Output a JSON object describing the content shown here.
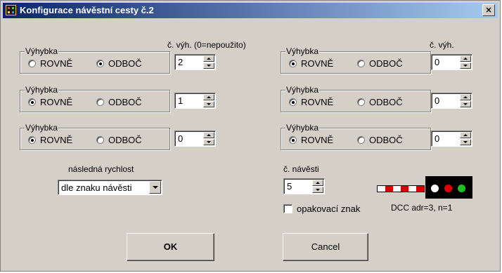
{
  "window": {
    "title": "Konfigurace návěstní cesty č.2",
    "close_label": "×"
  },
  "switches": [
    {
      "legend": "Výhybka",
      "straight_label": "ROVNĚ",
      "branch_label": "ODBOČ",
      "selected": "branch",
      "number": "2"
    },
    {
      "legend": "Výhybka",
      "straight_label": "ROVNĚ",
      "branch_label": "ODBOČ",
      "selected": "straight",
      "number": "1"
    },
    {
      "legend": "Výhybka",
      "straight_label": "ROVNĚ",
      "branch_label": "ODBOČ",
      "selected": "straight",
      "number": "0"
    },
    {
      "legend": "Výhybka",
      "straight_label": "ROVNĚ",
      "branch_label": "ODBOČ",
      "selected": "straight",
      "number": "0"
    },
    {
      "legend": "Výhybka",
      "straight_label": "ROVNĚ",
      "branch_label": "ODBOČ",
      "selected": "straight",
      "number": "0"
    },
    {
      "legend": "Výhybka",
      "straight_label": "ROVNĚ",
      "branch_label": "ODBOČ",
      "selected": "straight",
      "number": "0"
    }
  ],
  "labels": {
    "left_switch_number": "č. výh. (0=nepoužito)",
    "right_switch_number": "č. výh.",
    "following_speed": "následná rychlost",
    "signal_number": "č. návěsti"
  },
  "following_speed_value": "dle znaku návěsti",
  "signal_number_value": "5",
  "repeat_sign": {
    "label": "opakovací znak",
    "checked": false
  },
  "dcc_info": "DCC adr=3,  n=1",
  "signal_preview": {
    "rail_colors": [
      "#ffffff",
      "#d40000",
      "#ffffff",
      "#d40000",
      "#ffffff",
      "#d40000"
    ],
    "lamp_colors": [
      "#ffffff",
      "#e00000",
      "#20c020"
    ]
  },
  "buttons": {
    "ok": "OK",
    "cancel": "Cancel"
  }
}
